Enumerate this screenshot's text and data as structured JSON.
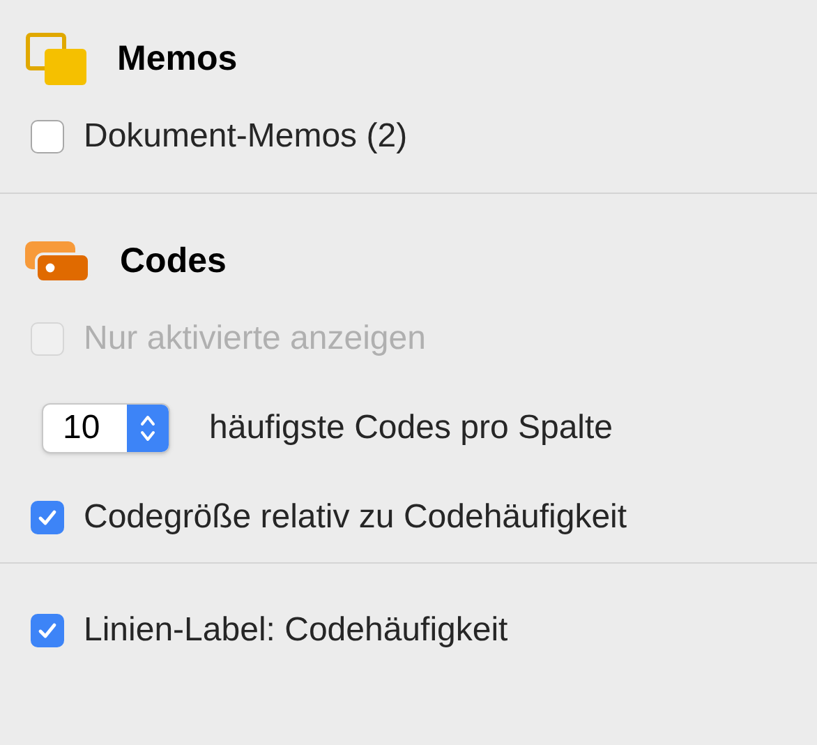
{
  "sections": [
    {
      "title": "Memos",
      "items": [
        {
          "kind": "checkbox",
          "label": "Dokument-Memos (2)",
          "checked": false,
          "disabled": false
        }
      ]
    },
    {
      "title": "Codes",
      "items": [
        {
          "kind": "checkbox",
          "label": "Nur aktivierte anzeigen",
          "checked": false,
          "disabled": true
        },
        {
          "kind": "stepper",
          "value": "10",
          "suffix": "häufigste Codes pro Spalte"
        },
        {
          "kind": "checkbox",
          "label": "Codegröße relativ zu Codehäufigkeit",
          "checked": true,
          "disabled": false
        }
      ]
    },
    {
      "items": [
        {
          "kind": "checkbox",
          "label": "Linien-Label: Codehäufigkeit",
          "checked": true,
          "disabled": false
        }
      ]
    }
  ]
}
